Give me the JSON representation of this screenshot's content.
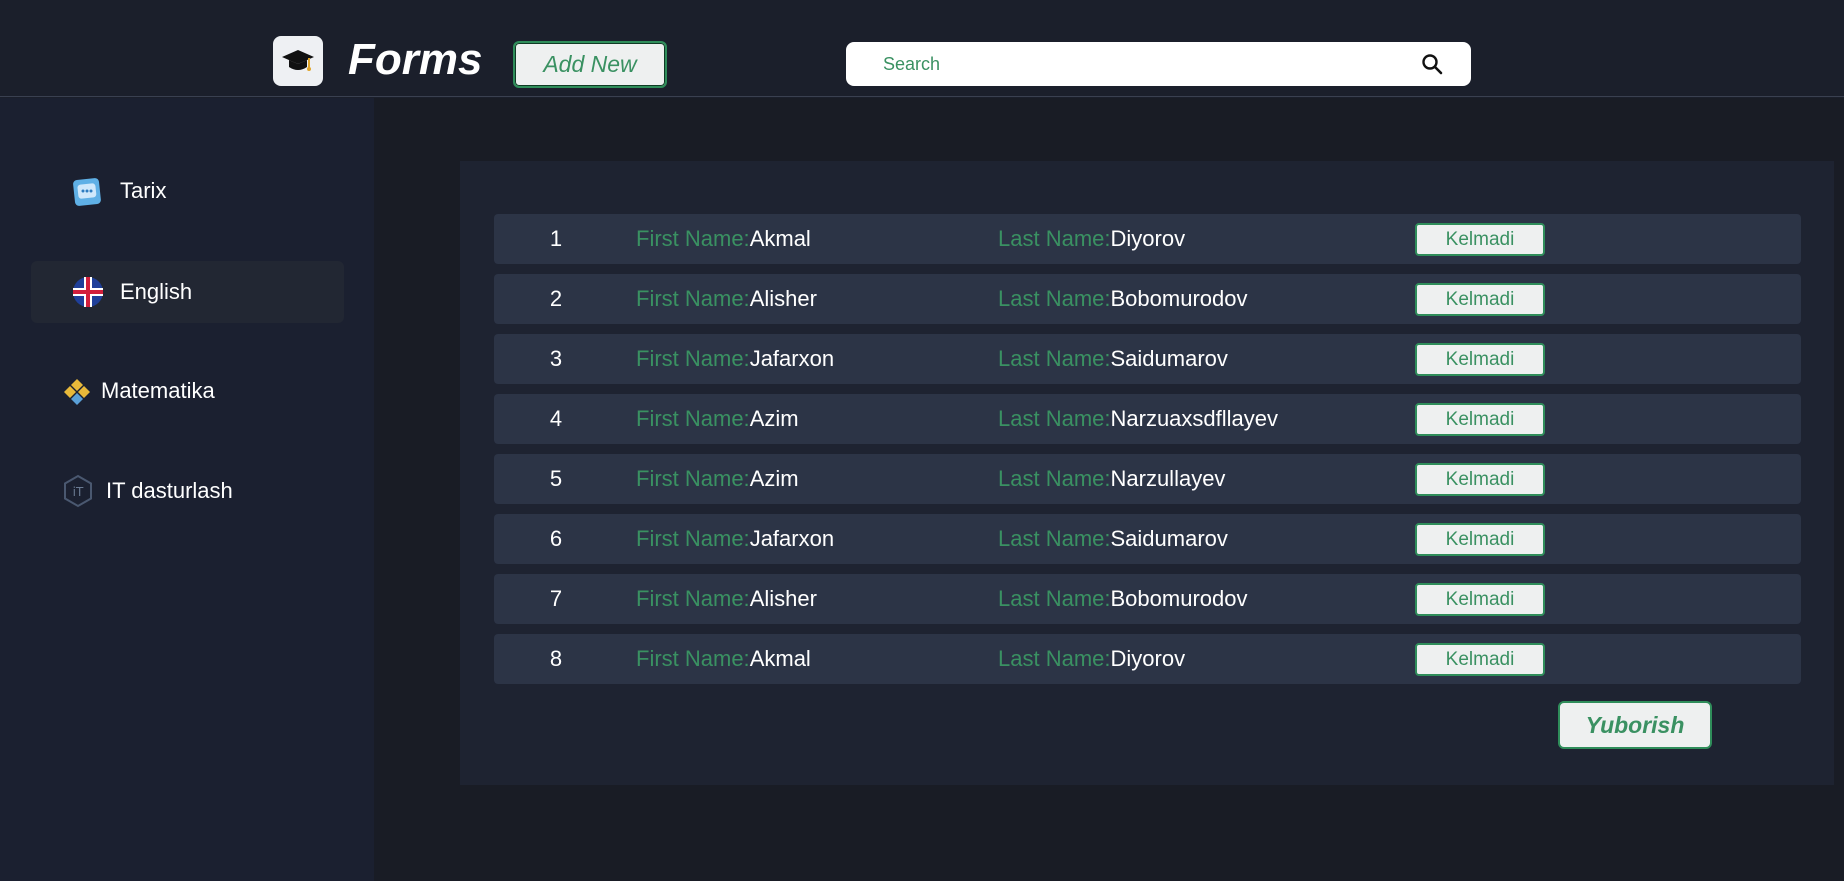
{
  "header": {
    "logo_icon": "graduation-cap-icon",
    "title": "Forms",
    "add_new_label": "Add New",
    "search": {
      "placeholder": "Search",
      "value": "",
      "icon": "search-icon"
    }
  },
  "sidebar": {
    "items": [
      {
        "label": "Tarix",
        "icon": "chat-bubble-icon",
        "active": false
      },
      {
        "label": "English",
        "icon": "uk-flag-icon",
        "active": true
      },
      {
        "label": "Matematika",
        "icon": "math-diamond-icon",
        "active": false
      },
      {
        "label": "IT dasturlash",
        "icon": "it-hexagon-icon",
        "active": false
      }
    ]
  },
  "table": {
    "first_name_label": "First Name:",
    "last_name_label": "Last Name:",
    "rows": [
      {
        "num": "1",
        "first": "Akmal",
        "last": "Diyorov",
        "status": "Kelmadi"
      },
      {
        "num": "2",
        "first": "Alisher",
        "last": "Bobomurodov",
        "status": "Kelmadi"
      },
      {
        "num": "3",
        "first": "Jafarxon",
        "last": "Saidumarov",
        "status": "Kelmadi"
      },
      {
        "num": "4",
        "first": "Azim",
        "last": "Narzuaxsdfllayev",
        "status": "Kelmadi"
      },
      {
        "num": "5",
        "first": "Azim",
        "last": "Narzullayev",
        "status": "Kelmadi"
      },
      {
        "num": "6",
        "first": "Jafarxon",
        "last": "Saidumarov",
        "status": "Kelmadi"
      },
      {
        "num": "7",
        "first": "Alisher",
        "last": "Bobomurodov",
        "status": "Kelmadi"
      },
      {
        "num": "8",
        "first": "Akmal",
        "last": "Diyorov",
        "status": "Kelmadi"
      }
    ]
  },
  "submit_label": "Yuborish",
  "colors": {
    "accent_green": "#3a9162",
    "background": "#1b1f2b",
    "row_background": "#2c3446"
  }
}
